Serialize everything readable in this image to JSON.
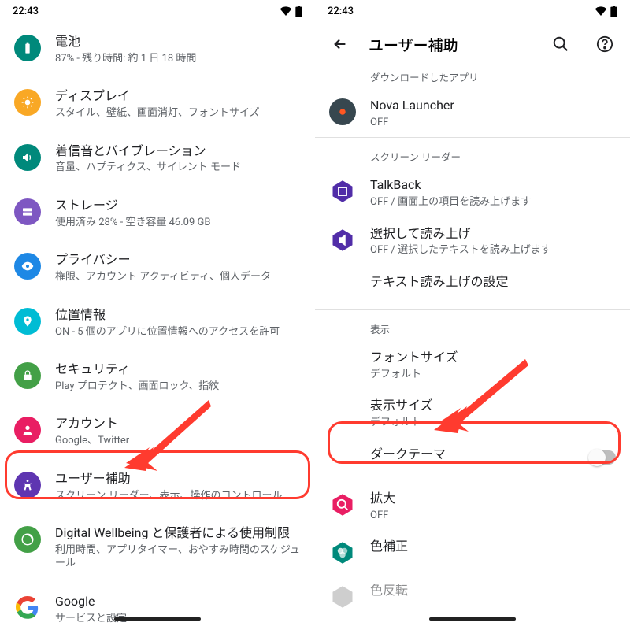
{
  "status": {
    "time": "22:43"
  },
  "left": {
    "items": [
      {
        "icon": "battery",
        "color": "#00897b",
        "title": "電池",
        "sub": "87% - 残り時間: 約 1 日 18 時間"
      },
      {
        "icon": "display",
        "color": "#f9a825",
        "title": "ディスプレイ",
        "sub": "スタイル、壁紙、画面消灯、フォントサイズ"
      },
      {
        "icon": "sound",
        "color": "#00897b",
        "title": "着信音とバイブレーション",
        "sub": "音量、ハプティクス、サイレント モード"
      },
      {
        "icon": "storage",
        "color": "#7e57c2",
        "title": "ストレージ",
        "sub": "使用済み 28% - 空き容量 46.09 GB"
      },
      {
        "icon": "privacy",
        "color": "#1e88e5",
        "title": "プライバシー",
        "sub": "権限、アカウント アクティビティ、個人データ"
      },
      {
        "icon": "location",
        "color": "#00bcd4",
        "title": "位置情報",
        "sub": "ON - 5 個のアプリに位置情報へのアクセスを許可"
      },
      {
        "icon": "security",
        "color": "#43a047",
        "title": "セキュリティ",
        "sub": "Play プロテクト、画面ロック、指紋"
      },
      {
        "icon": "account",
        "color": "#e91e63",
        "title": "アカウント",
        "sub": "Google、Twitter"
      },
      {
        "icon": "a11y",
        "color": "#5e35b1",
        "title": "ユーザー補助",
        "sub": "スクリーン リーダー、表示、操作のコントロール"
      },
      {
        "icon": "wellbeing",
        "color": "#43a047",
        "title": "Digital Wellbeing と保護者による使用制限",
        "sub": "利用時間、アプリタイマー、おやすみ時間のスケジュール"
      },
      {
        "icon": "google",
        "color": "#ffffff",
        "title": "Google",
        "sub": "サービスと設定"
      }
    ]
  },
  "right": {
    "appbar_title": "ユーザー補助",
    "sections": {
      "downloaded": "ダウンロードしたアプリ",
      "screenreader": "スクリーン リーダー",
      "display": "表示"
    },
    "nova": {
      "title": "Nova Launcher",
      "sub": "OFF"
    },
    "talkback": {
      "title": "TalkBack",
      "sub": "OFF / 画面上の項目を読み上げます"
    },
    "select": {
      "title": "選択して読み上げ",
      "sub": "OFF / 選択したテキストを読み上げます"
    },
    "tts": {
      "title": "テキスト読み上げの設定"
    },
    "fontsize": {
      "title": "フォントサイズ",
      "sub": "デフォルト"
    },
    "dispsize": {
      "title": "表示サイズ",
      "sub": "デフォルト"
    },
    "dark": {
      "title": "ダークテーマ"
    },
    "magnify": {
      "title": "拡大",
      "sub": "OFF"
    },
    "colorcorr": {
      "title": "色補正"
    },
    "colorinv": {
      "title": "色反転"
    }
  }
}
